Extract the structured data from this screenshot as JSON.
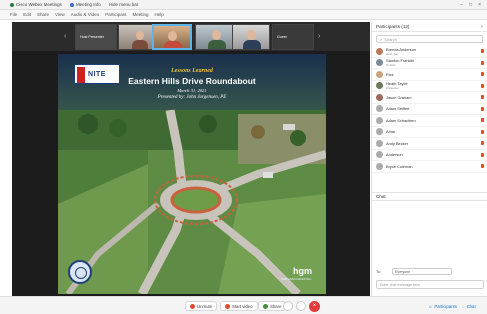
{
  "window": {
    "tab_meeting": "Cisco Webex Meetings",
    "tab_meeting_info": "Meeting Info",
    "tab_hide_menu": "Hide menu bar",
    "app_accent": "#2a7a3a"
  },
  "menubar": [
    "File",
    "Edit",
    "Share",
    "View",
    "Audio & Video",
    "Participant",
    "Meeting",
    "Help"
  ],
  "strip": {
    "tile_left_name": "Host Presenter",
    "tile_right_name": "Guest"
  },
  "slide": {
    "kicker": "Lessons Learned",
    "title": "Eastern Hills Drive Roundabout",
    "date": "March 31, 2021",
    "presenter": "Presented by: John Jorgensen, PE",
    "logo_left": "NITE",
    "logo_right": "hgm",
    "logo_right_sub": "HGM ASSOCIATES INC."
  },
  "panel": {
    "title": "Participants (12)",
    "search_placeholder": "Search",
    "chat_title": "Chat",
    "chat_to_label": "To:",
    "chat_to_value": "Everyone",
    "chat_placeholder": "Enter chat message here",
    "participants": [
      {
        "name": "Brenda Anderson",
        "sub": "Host, me",
        "tag": ""
      },
      {
        "name": "Stanton Franklin",
        "sub": "Cohost",
        "tag": ""
      },
      {
        "name": "Rick",
        "sub": "",
        "tag": ""
      },
      {
        "name": "Heath Taylor",
        "sub": "Presenter",
        "tag": ""
      },
      {
        "name": "Jason Graham",
        "sub": "",
        "tag": ""
      },
      {
        "name": "Adam Seiffert",
        "sub": "",
        "tag": ""
      },
      {
        "name": "Adam Schachten",
        "sub": "",
        "tag": ""
      },
      {
        "name": "Amal",
        "sub": "",
        "tag": ""
      },
      {
        "name": "Andy Becker",
        "sub": "",
        "tag": ""
      },
      {
        "name": "Anderson",
        "sub": "",
        "tag": ""
      },
      {
        "name": "Bryce Coleman",
        "sub": "",
        "tag": ""
      }
    ]
  },
  "controls": {
    "mute": "Unmute",
    "video": "Start video",
    "share": "Share",
    "participants_btn": "Participants",
    "chat_btn": "Chat"
  }
}
